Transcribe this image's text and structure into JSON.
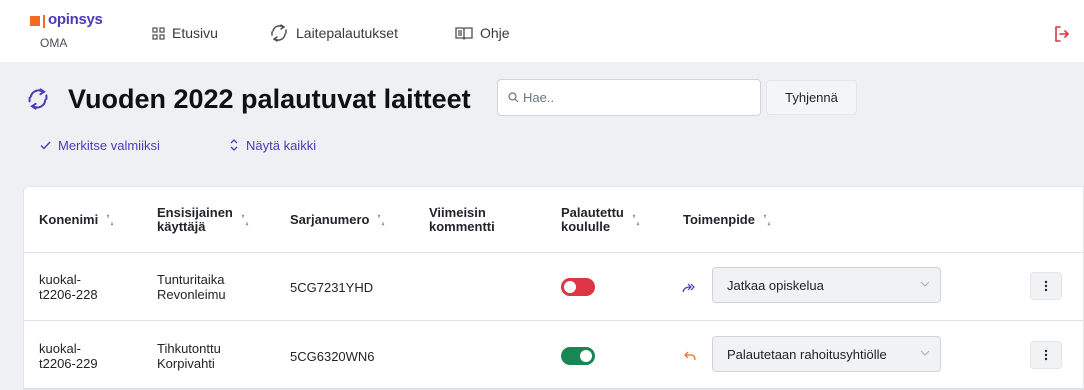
{
  "topbar": {
    "logo_name": "opinsys",
    "logo_sub": "OMA",
    "nav": [
      {
        "label": "Etusivu",
        "icon": "dashboard-icon"
      },
      {
        "label": "Laitepalautukset",
        "icon": "recycle-icon"
      },
      {
        "label": "Ohje",
        "icon": "book-icon"
      }
    ],
    "logout_icon": "logout-icon"
  },
  "page": {
    "title": "Vuoden 2022 palautuvat laitteet",
    "search_placeholder": "Hae..",
    "search_value": "",
    "clear_label": "Tyhjennä",
    "mark_done_label": "Merkitse valmiiksi",
    "show_all_label": "Näytä kaikki"
  },
  "table": {
    "headers": {
      "konenimi": "Konenimi",
      "kayttaja_1": "Ensisijainen",
      "kayttaja_2": "käyttäjä",
      "sarjanumero": "Sarjanumero",
      "kommentti_1": "Viimeisin",
      "kommentti_2": "kommentti",
      "palautettu_1": "Palautettu",
      "palautettu_2": "koululle",
      "toimenpide": "Toimenpide"
    },
    "rows": [
      {
        "name_1": "kuokal-",
        "name_2": "t2206-228",
        "user_1": "Tunturitaika",
        "user_2": "Revonleimu",
        "serial": "5CG7231YHD",
        "comment": "",
        "returned": false,
        "action_icon": "forward-arrow-icon",
        "action": "Jatkaa opiskelua"
      },
      {
        "name_1": "kuokal-",
        "name_2": "t2206-229",
        "user_1": "Tihkutonttu",
        "user_2": "Korpivahti",
        "serial": "5CG6320WN6",
        "comment": "",
        "returned": true,
        "action_icon": "return-arrow-icon",
        "action": "Palautetaan rahoitusyhtiölle"
      }
    ]
  },
  "colors": {
    "brand_orange": "#f26b21",
    "brand_purple": "#4b3bb5",
    "toggle_off": "#dc3545",
    "toggle_on": "#198754"
  }
}
